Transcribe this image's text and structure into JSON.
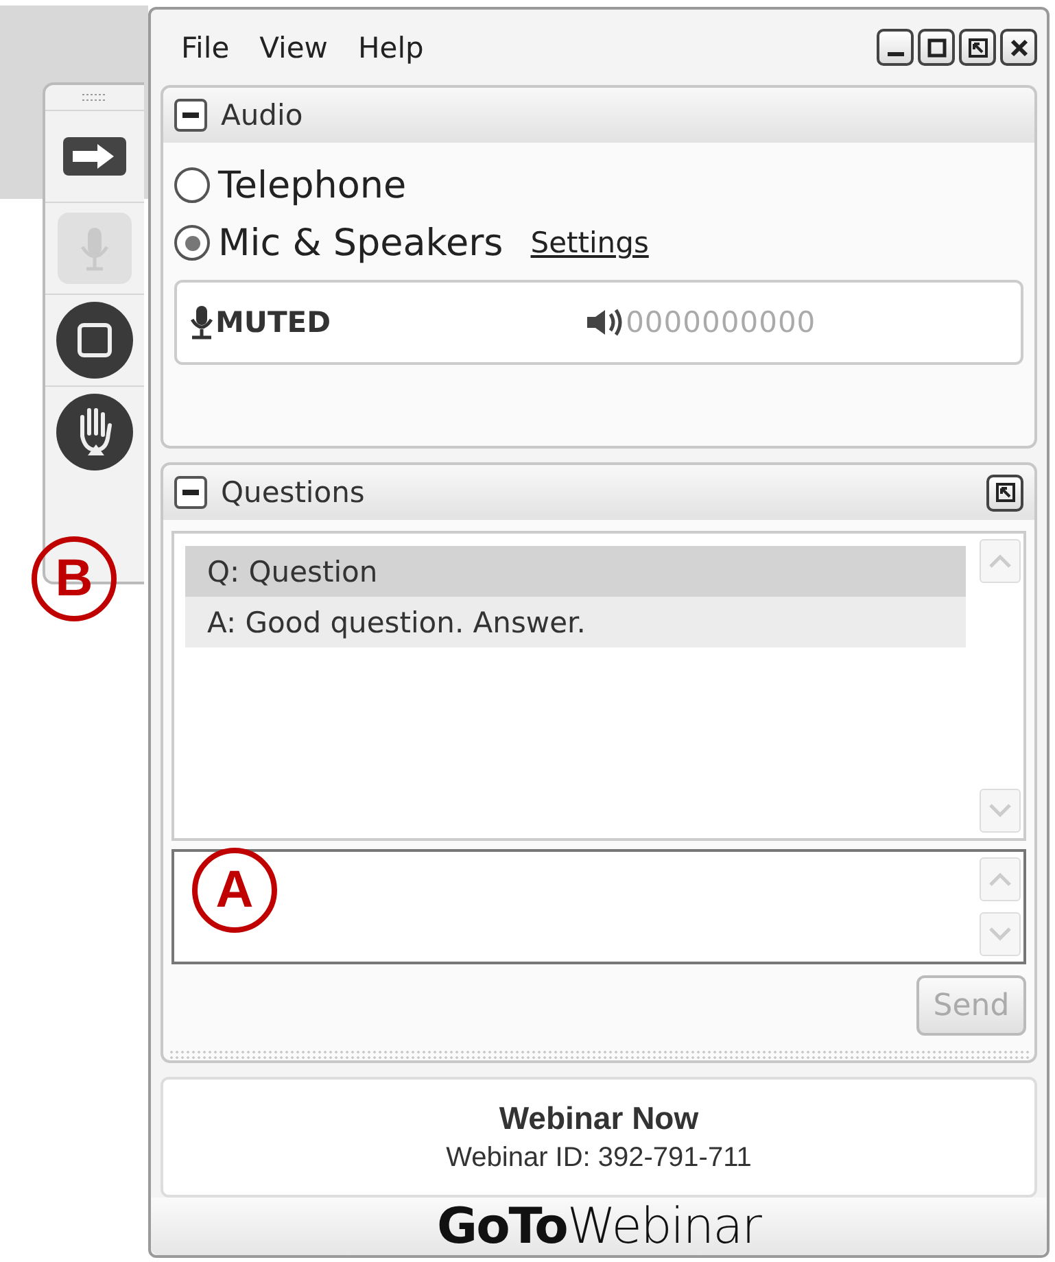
{
  "toolbar": {
    "buttons": [
      {
        "kind": "arrow",
        "disabled": false
      },
      {
        "kind": "mic",
        "disabled": true
      },
      {
        "kind": "stop",
        "disabled": false
      },
      {
        "kind": "hand",
        "disabled": false
      }
    ]
  },
  "menu": [
    "File",
    "View",
    "Help"
  ],
  "audio": {
    "title": "Audio",
    "expanded": true,
    "options": [
      {
        "label": "Telephone",
        "selected": false
      },
      {
        "label": "Mic & Speakers",
        "selected": true
      }
    ],
    "settings_link": "Settings",
    "mic_status": "MUTED",
    "speaker_level": "0000000000"
  },
  "questions": {
    "title": "Questions",
    "expanded": true,
    "items": [
      {
        "text": "Q: Question",
        "selected": true
      },
      {
        "text": "A: Good question. Answer.",
        "selected": false
      }
    ],
    "send_button": "Send",
    "send_disabled": true
  },
  "webinar": {
    "name": "Webinar Now",
    "id_line": "Webinar ID: 392-791-711"
  },
  "logo": "**GoTo**Webinar",
  "annotations": [
    "A",
    "B"
  ]
}
